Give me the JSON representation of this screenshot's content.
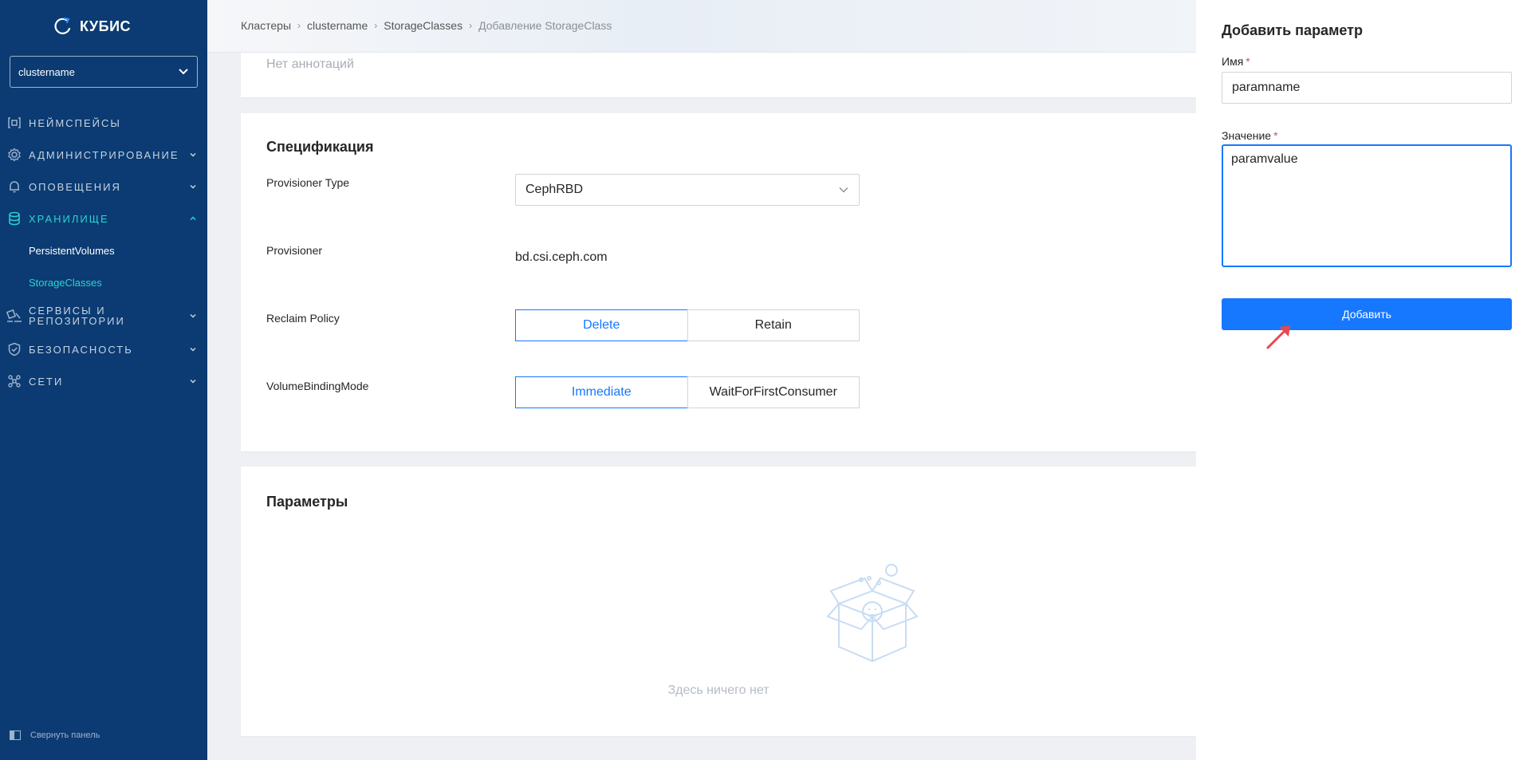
{
  "sidebar": {
    "logo_text": "КУБИС",
    "cluster_select_value": "clustername",
    "items": [
      {
        "label": "Неймспейсы",
        "icon": "namespaces-icon"
      },
      {
        "label": "Администрирование",
        "icon": "gear-icon"
      },
      {
        "label": "Оповещения",
        "icon": "bell-icon"
      },
      {
        "label": "Хранилище",
        "icon": "database-icon",
        "expanded": true
      },
      {
        "label": "Сервисы и репозитории",
        "icon": "services-icon"
      },
      {
        "label": "Безопасность",
        "icon": "shield-icon"
      },
      {
        "label": "Сети",
        "icon": "network-icon"
      }
    ],
    "storage_subitems": [
      {
        "label": "PersistentVolumes"
      },
      {
        "label": "StorageClasses",
        "active": true
      }
    ],
    "collapse_label": "Свернуть панель"
  },
  "header": {
    "breadcrumb": [
      "Кластеры",
      "clustername",
      "StorageClasses",
      "Добавление StorageClass"
    ]
  },
  "annotations_card": {
    "empty_text": "Нет аннотаций"
  },
  "spec_card": {
    "title": "Спецификация",
    "provisioner_type_label": "Provisioner Type",
    "provisioner_type_value": "CephRBD",
    "provisioner_label": "Provisioner",
    "provisioner_value": "bd.csi.ceph.com",
    "reclaim_policy_label": "Reclaim Policy",
    "reclaim_policy_options": [
      "Delete",
      "Retain"
    ],
    "reclaim_policy_selected": "Delete",
    "binding_mode_label": "VolumeBindingMode",
    "binding_mode_options": [
      "Immediate",
      "WaitForFirstConsumer"
    ],
    "binding_mode_selected": "Immediate"
  },
  "params_card": {
    "title": "Параметры",
    "empty_text": "Здесь ничего нет"
  },
  "drawer": {
    "title": "Добавить параметр",
    "name_label": "Имя",
    "name_value": "paramname",
    "value_label": "Значение",
    "value_value": "paramvalue",
    "required_mark": "*",
    "submit_label": "Добавить"
  },
  "colors": {
    "sidebar_bg": "#0b3b72",
    "accent": "#1677ff",
    "active_nav": "#2ad4d1",
    "required": "#e5484d",
    "annotation_arrow": "#e5484d"
  }
}
